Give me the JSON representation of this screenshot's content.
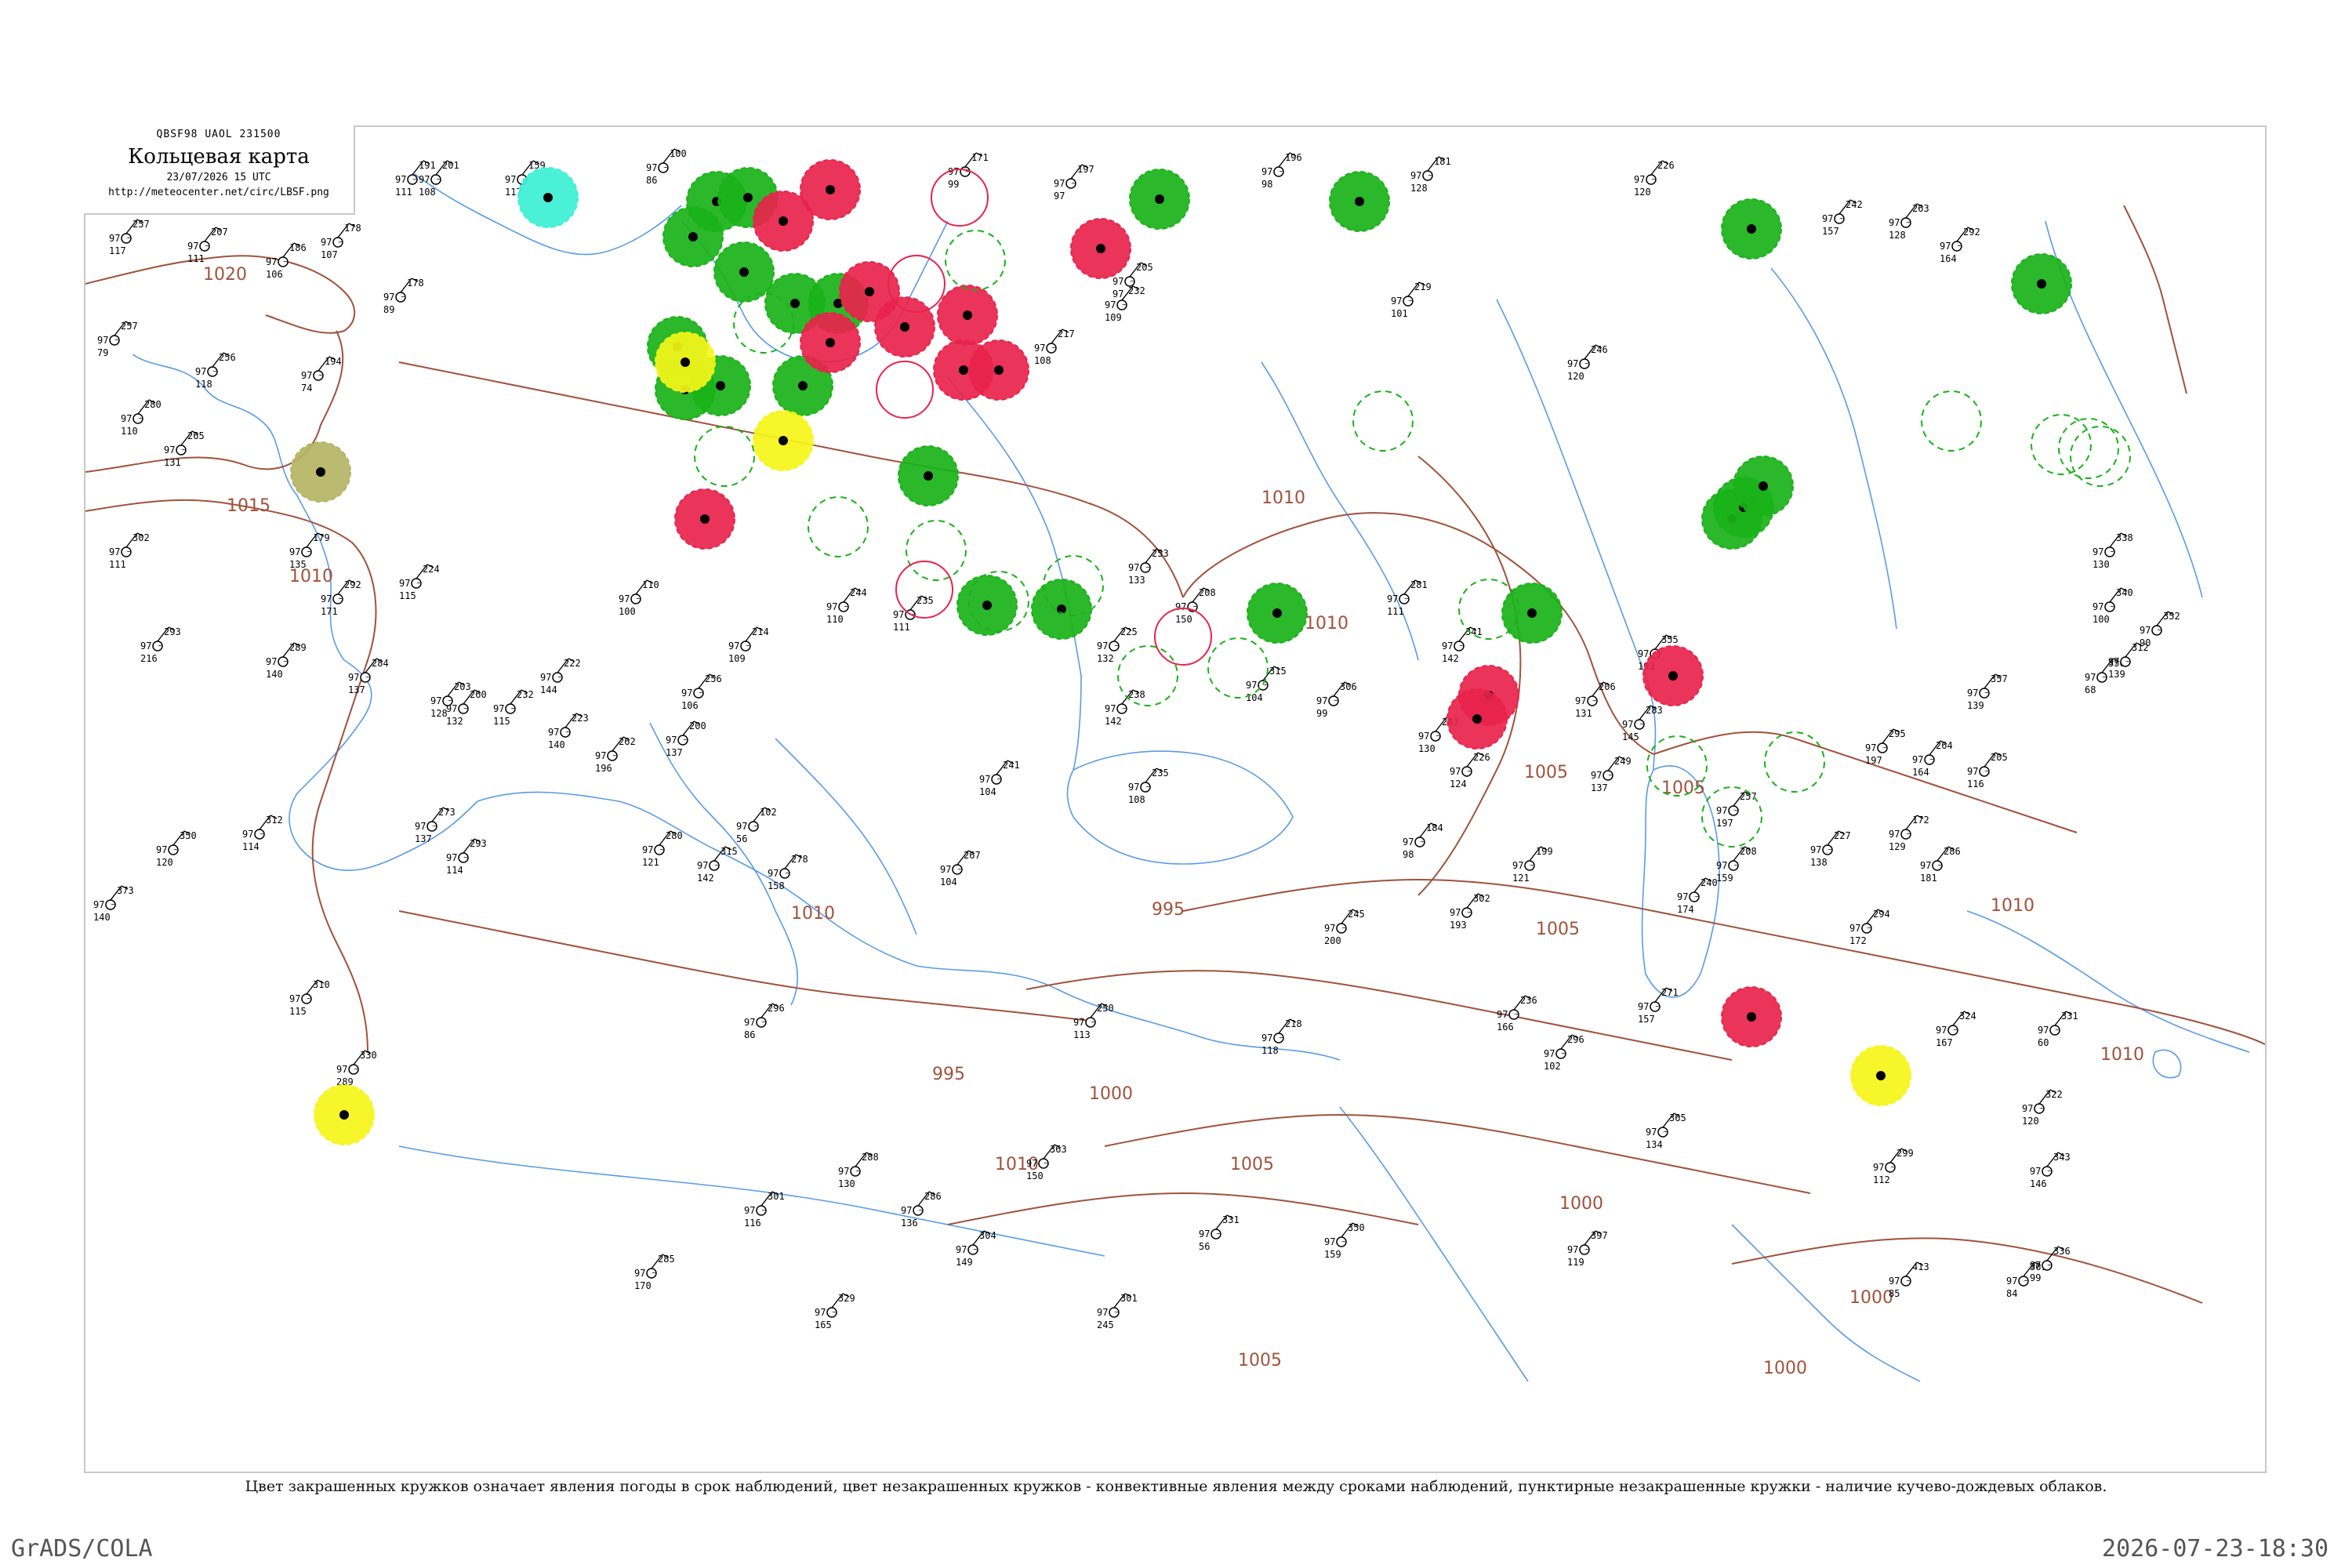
{
  "header": {
    "code": "QBSF98  UAOL  231500",
    "title": "Кольцевая карта",
    "time": "23/07/2026 15 UTC",
    "url": "http://meteocenter.net/circ/LBSF.png"
  },
  "caption": "Цвет закрашенных кружков означает явления погоды в срок наблюдений, цвет незакрашенных кружков - конвективные явления между сроками наблюдений, пунктирные незакрашенные кружки - наличие кучево-дождевых облаков.",
  "footer": {
    "left": "GrADS/COLA",
    "right": "2026-07-23-18:30"
  },
  "colors": {
    "isobar": "#a0523c",
    "water": "#4a90e2",
    "green": "#19b219",
    "red": "#e8234b",
    "yellow": "#f5f519",
    "cyan": "#3cf0d2",
    "olive": "#b4b464"
  },
  "isobars": [
    {
      "value": "1020"
    },
    {
      "value": "1015"
    },
    {
      "value": "1010"
    },
    {
      "value": "1010"
    },
    {
      "value": "1010"
    },
    {
      "value": "1010"
    },
    {
      "value": "1010"
    },
    {
      "value": "1005"
    },
    {
      "value": "1005"
    },
    {
      "value": "1005"
    },
    {
      "value": "1005"
    },
    {
      "value": "1005"
    },
    {
      "value": "1000"
    },
    {
      "value": "1000"
    },
    {
      "value": "1000"
    },
    {
      "value": "1000"
    },
    {
      "value": "995"
    },
    {
      "value": "995"
    },
    {
      "value": "1010"
    },
    {
      "value": "1010"
    }
  ],
  "markers": [
    {
      "type": "filled",
      "color": "green"
    },
    {
      "type": "filled",
      "color": "green"
    },
    {
      "type": "filled",
      "color": "green"
    },
    {
      "type": "filled",
      "color": "green"
    },
    {
      "type": "filled",
      "color": "green"
    },
    {
      "type": "filled",
      "color": "green"
    },
    {
      "type": "filled",
      "color": "green"
    },
    {
      "type": "filled",
      "color": "green"
    },
    {
      "type": "filled",
      "color": "green"
    },
    {
      "type": "filled",
      "color": "green"
    },
    {
      "type": "filled",
      "color": "green"
    },
    {
      "type": "filled",
      "color": "green"
    },
    {
      "type": "filled",
      "color": "green"
    },
    {
      "type": "filled",
      "color": "green"
    },
    {
      "type": "filled",
      "color": "green"
    },
    {
      "type": "filled",
      "color": "green"
    },
    {
      "type": "filled",
      "color": "green"
    },
    {
      "type": "filled",
      "color": "green"
    },
    {
      "type": "filled",
      "color": "green"
    },
    {
      "type": "filled",
      "color": "green"
    },
    {
      "type": "filled",
      "color": "green"
    },
    {
      "type": "filled",
      "color": "green"
    },
    {
      "type": "filled",
      "color": "red"
    },
    {
      "type": "filled",
      "color": "red"
    },
    {
      "type": "filled",
      "color": "red"
    },
    {
      "type": "filled",
      "color": "red"
    },
    {
      "type": "filled",
      "color": "red"
    },
    {
      "type": "filled",
      "color": "red"
    },
    {
      "type": "filled",
      "color": "red"
    },
    {
      "type": "filled",
      "color": "red"
    },
    {
      "type": "filled",
      "color": "red"
    },
    {
      "type": "filled",
      "color": "red"
    },
    {
      "type": "filled",
      "color": "red"
    },
    {
      "type": "filled",
      "color": "red"
    },
    {
      "type": "filled",
      "color": "red"
    },
    {
      "type": "filled",
      "color": "red"
    },
    {
      "type": "filled",
      "color": "yellow"
    },
    {
      "type": "filled",
      "color": "yellow"
    },
    {
      "type": "filled",
      "color": "yellow"
    },
    {
      "type": "filled",
      "color": "yellow"
    },
    {
      "type": "filled",
      "color": "cyan"
    },
    {
      "type": "filled",
      "color": "olive"
    },
    {
      "type": "dashed",
      "color": "green"
    },
    {
      "type": "dashed",
      "color": "green"
    },
    {
      "type": "dashed",
      "color": "green"
    },
    {
      "type": "dashed",
      "color": "green"
    },
    {
      "type": "dashed",
      "color": "green"
    },
    {
      "type": "dashed",
      "color": "green"
    },
    {
      "type": "dashed",
      "color": "green"
    },
    {
      "type": "dashed",
      "color": "green"
    },
    {
      "type": "dashed",
      "color": "green"
    },
    {
      "type": "dashed",
      "color": "green"
    },
    {
      "type": "dashed",
      "color": "green"
    },
    {
      "type": "dashed",
      "color": "green"
    },
    {
      "type": "dashed",
      "color": "green"
    },
    {
      "type": "dashed",
      "color": "green"
    },
    {
      "type": "dashed",
      "color": "green"
    },
    {
      "type": "dashed",
      "color": "green"
    },
    {
      "type": "dashed",
      "color": "green"
    },
    {
      "type": "dashed",
      "color": "green"
    },
    {
      "type": "ring",
      "color": "red"
    },
    {
      "type": "ring",
      "color": "red"
    },
    {
      "type": "ring",
      "color": "red"
    },
    {
      "type": "ring",
      "color": "red"
    },
    {
      "type": "ring",
      "color": "red"
    }
  ],
  "stations": [
    {
      "p": "257",
      "t": "97",
      "d": "117"
    },
    {
      "p": "207",
      "t": "97",
      "d": "111"
    },
    {
      "p": "186",
      "t": "97",
      "d": "106"
    },
    {
      "p": "178",
      "t": "97",
      "d": "107"
    },
    {
      "p": "191",
      "t": "97",
      "d": "111"
    },
    {
      "p": "201",
      "t": "97",
      "d": "108"
    },
    {
      "p": "159",
      "t": "97",
      "d": "117"
    },
    {
      "p": "100",
      "t": "97",
      "d": "86"
    },
    {
      "p": "171",
      "t": "97",
      "d": "99"
    },
    {
      "p": "197",
      "t": "97",
      "d": "97"
    },
    {
      "p": "196",
      "t": "97",
      "d": "98"
    },
    {
      "p": "181",
      "t": "97",
      "d": "128"
    },
    {
      "p": "226",
      "t": "97",
      "d": "120"
    },
    {
      "p": "242",
      "t": "97",
      "d": "157"
    },
    {
      "p": "263",
      "t": "97",
      "d": "128"
    },
    {
      "p": "292",
      "t": "97",
      "d": "164"
    },
    {
      "p": "257",
      "t": "97",
      "d": "79"
    },
    {
      "p": "256",
      "t": "97",
      "d": "118"
    },
    {
      "p": "194",
      "t": "97",
      "d": "74"
    },
    {
      "p": "178",
      "t": "97",
      "d": "89"
    },
    {
      "p": "217",
      "t": "97",
      "d": "108"
    },
    {
      "p": "205",
      "t": "97",
      "d": "97"
    },
    {
      "p": "232",
      "t": "97",
      "d": "109"
    },
    {
      "p": "219",
      "t": "97",
      "d": "101"
    },
    {
      "p": "246",
      "t": "97",
      "d": "120"
    },
    {
      "p": "302",
      "t": "97",
      "d": "111"
    },
    {
      "p": "280",
      "t": "97",
      "d": "110"
    },
    {
      "p": "265",
      "t": "97",
      "d": "131"
    },
    {
      "p": "179",
      "t": "97",
      "d": "135"
    },
    {
      "p": "292",
      "t": "97",
      "d": "171"
    },
    {
      "p": "224",
      "t": "97",
      "d": "115"
    },
    {
      "p": "110",
      "t": "97",
      "d": "100"
    },
    {
      "p": "244",
      "t": "97",
      "d": "110"
    },
    {
      "p": "235",
      "t": "97",
      "d": "111"
    },
    {
      "p": "225",
      "t": "97",
      "d": "132"
    },
    {
      "p": "253",
      "t": "97",
      "d": "133"
    },
    {
      "p": "208",
      "t": "97",
      "d": "150"
    },
    {
      "p": "341",
      "t": "97",
      "d": "142"
    },
    {
      "p": "355",
      "t": "97",
      "d": "193"
    },
    {
      "p": "293",
      "t": "97",
      "d": "216"
    },
    {
      "p": "289",
      "t": "97",
      "d": "140"
    },
    {
      "p": "284",
      "t": "97",
      "d": "137"
    },
    {
      "p": "260",
      "t": "97",
      "d": "132"
    },
    {
      "p": "222",
      "t": "97",
      "d": "144"
    },
    {
      "p": "200",
      "t": "97",
      "d": "137"
    },
    {
      "p": "278",
      "t": "97",
      "d": "158"
    },
    {
      "p": "302",
      "t": "97",
      "d": "193"
    },
    {
      "p": "315",
      "t": "97",
      "d": "142"
    },
    {
      "p": "273",
      "t": "97",
      "d": "137"
    },
    {
      "p": "102",
      "t": "97",
      "d": "56"
    },
    {
      "p": "241",
      "t": "97",
      "d": "104"
    },
    {
      "p": "235",
      "t": "97",
      "d": "108"
    },
    {
      "p": "267",
      "t": "97",
      "d": "104"
    },
    {
      "p": "208",
      "t": "97",
      "d": "159"
    },
    {
      "p": "240",
      "t": "97",
      "d": "174"
    },
    {
      "p": "286",
      "t": "97",
      "d": "181"
    },
    {
      "p": "350",
      "t": "97",
      "d": "120"
    },
    {
      "p": "312",
      "t": "97",
      "d": "114"
    },
    {
      "p": "293",
      "t": "97",
      "d": "114"
    },
    {
      "p": "280",
      "t": "97",
      "d": "121"
    },
    {
      "p": "245",
      "t": "97",
      "d": "200"
    },
    {
      "p": "236",
      "t": "97",
      "d": "166"
    },
    {
      "p": "271",
      "t": "97",
      "d": "157"
    },
    {
      "p": "294",
      "t": "97",
      "d": "172"
    },
    {
      "p": "373",
      "t": "97",
      "d": "140"
    },
    {
      "p": "310",
      "t": "97",
      "d": "115"
    },
    {
      "p": "330",
      "t": "97",
      "d": "289"
    },
    {
      "p": "296",
      "t": "97",
      "d": "86"
    },
    {
      "p": "250",
      "t": "97",
      "d": "113"
    },
    {
      "p": "218",
      "t": "97",
      "d": "118"
    },
    {
      "p": "296",
      "t": "97",
      "d": "102"
    },
    {
      "p": "324",
      "t": "97",
      "d": "167"
    },
    {
      "p": "331",
      "t": "97",
      "d": "60"
    },
    {
      "p": "322",
      "t": "97",
      "d": "120"
    },
    {
      "p": "365",
      "t": "97",
      "d": "134"
    },
    {
      "p": "299",
      "t": "97",
      "d": "112"
    },
    {
      "p": "363",
      "t": "97",
      "d": "150"
    },
    {
      "p": "288",
      "t": "97",
      "d": "130"
    },
    {
      "p": "301",
      "t": "97",
      "d": "116"
    },
    {
      "p": "286",
      "t": "97",
      "d": "136"
    },
    {
      "p": "331",
      "t": "97",
      "d": "56"
    },
    {
      "p": "350",
      "t": "97",
      "d": "159"
    },
    {
      "p": "397",
      "t": "97",
      "d": "119"
    },
    {
      "p": "413",
      "t": "97",
      "d": "85"
    },
    {
      "p": "361",
      "t": "97",
      "d": "84"
    },
    {
      "p": "336",
      "t": "97",
      "d": "99"
    },
    {
      "p": "285",
      "t": "97",
      "d": "170"
    },
    {
      "p": "329",
      "t": "97",
      "d": "165"
    },
    {
      "p": "304",
      "t": "97",
      "d": "149"
    },
    {
      "p": "301",
      "t": "97",
      "d": "245"
    },
    {
      "p": "356",
      "t": "97",
      "d": "68"
    },
    {
      "p": "352",
      "t": "97",
      "d": "90"
    },
    {
      "p": "340",
      "t": "97",
      "d": "100"
    },
    {
      "p": "312",
      "t": "97",
      "d": "139"
    },
    {
      "p": "338",
      "t": "97",
      "d": "130"
    },
    {
      "p": "343",
      "t": "97",
      "d": "146"
    },
    {
      "p": "357",
      "t": "97",
      "d": "139"
    },
    {
      "p": "295",
      "t": "97",
      "d": "197"
    },
    {
      "p": "264",
      "t": "97",
      "d": "164"
    },
    {
      "p": "205",
      "t": "97",
      "d": "116"
    },
    {
      "p": "172",
      "t": "97",
      "d": "129"
    },
    {
      "p": "184",
      "t": "97",
      "d": "98"
    },
    {
      "p": "243",
      "t": "97",
      "d": "130"
    },
    {
      "p": "226",
      "t": "97",
      "d": "124"
    },
    {
      "p": "206",
      "t": "97",
      "d": "131"
    },
    {
      "p": "283",
      "t": "97",
      "d": "145"
    },
    {
      "p": "249",
      "t": "97",
      "d": "137"
    },
    {
      "p": "238",
      "t": "97",
      "d": "142"
    },
    {
      "p": "315",
      "t": "97",
      "d": "104"
    },
    {
      "p": "306",
      "t": "97",
      "d": "99"
    },
    {
      "p": "281",
      "t": "97",
      "d": "111"
    },
    {
      "p": "256",
      "t": "97",
      "d": "106"
    },
    {
      "p": "214",
      "t": "97",
      "d": "109"
    },
    {
      "p": "232",
      "t": "97",
      "d": "115"
    },
    {
      "p": "203",
      "t": "97",
      "d": "128"
    },
    {
      "p": "223",
      "t": "97",
      "d": "140"
    },
    {
      "p": "262",
      "t": "97",
      "d": "196"
    },
    {
      "p": "257",
      "t": "97",
      "d": "197"
    },
    {
      "p": "227",
      "t": "97",
      "d": "138"
    },
    {
      "p": "199",
      "t": "97",
      "d": "121"
    }
  ]
}
